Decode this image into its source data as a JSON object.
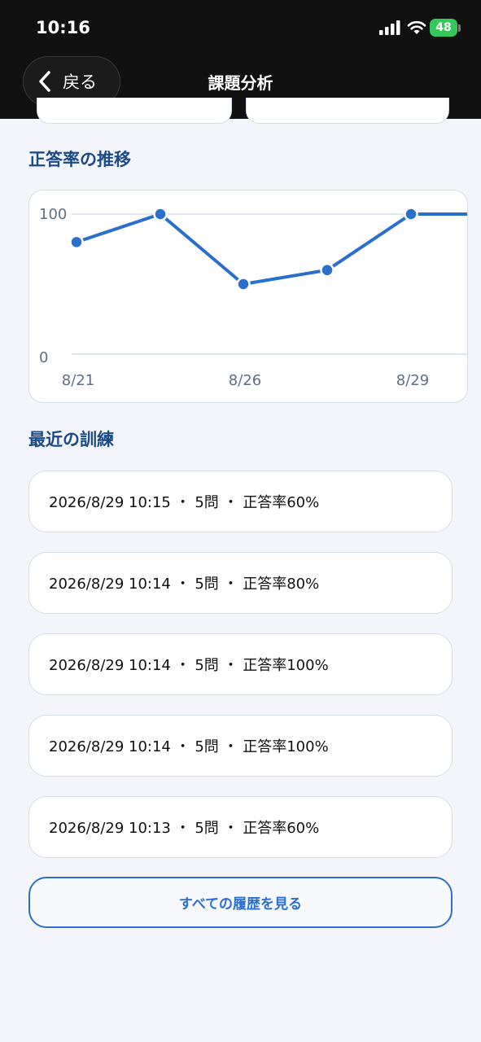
{
  "status_bar": {
    "time": "10:16",
    "battery": "48"
  },
  "nav": {
    "back_label": "戻る",
    "title": "課題分析"
  },
  "trend_section": {
    "title": "正答率の推移"
  },
  "chart_data": {
    "type": "line",
    "y_ticks": [
      "100",
      "0"
    ],
    "ylim": [
      0,
      100
    ],
    "x_tick_labels": [
      "8/21",
      "8/26",
      "8/29"
    ],
    "series": [
      {
        "values": [
          80,
          100,
          50,
          60,
          100,
          100
        ],
        "color": "#2a6fcc"
      }
    ],
    "grid": true
  },
  "recent_section": {
    "title": "最近の訓練"
  },
  "sessions": [
    {
      "text": "2026/8/29 10:15 ・ 5問 ・ 正答率60%"
    },
    {
      "text": "2026/8/29 10:14 ・ 5問 ・ 正答率80%"
    },
    {
      "text": "2026/8/29 10:14 ・ 5問 ・ 正答率100%"
    },
    {
      "text": "2026/8/29 10:14 ・ 5問 ・ 正答率100%"
    },
    {
      "text": "2026/8/29 10:13 ・ 5問 ・ 正答率60%"
    }
  ],
  "history_button": {
    "label": "すべての履歴を見る"
  },
  "colors": {
    "accent": "#2a6fcc",
    "section_title": "#1b4a87",
    "topbar": "#111111"
  }
}
